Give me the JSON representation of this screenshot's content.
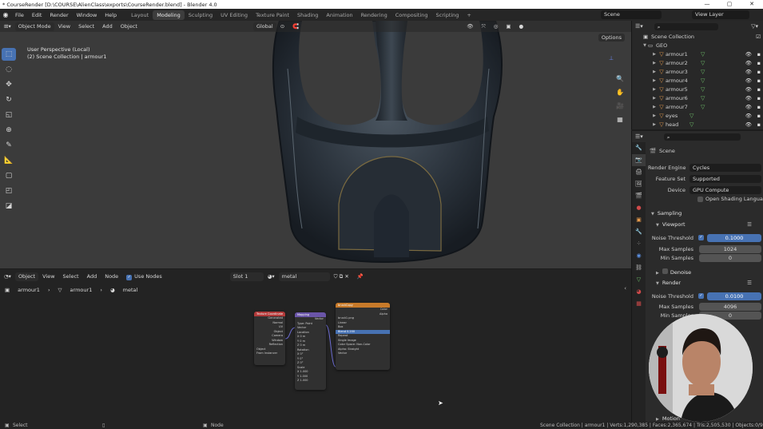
{
  "window": {
    "title": "* CourseRender [D:\\COURSE\\AlienClass\\exports\\CourseRender.blend] - Blender 4.0",
    "controls": [
      "—",
      "▢",
      "✕"
    ]
  },
  "menu": [
    "File",
    "Edit",
    "Render",
    "Window",
    "Help"
  ],
  "workspaces": [
    "Layout",
    "Modeling",
    "Sculpting",
    "UV Editing",
    "Texture Paint",
    "Shading",
    "Animation",
    "Rendering",
    "Compositing",
    "Scripting",
    "+"
  ],
  "active_workspace": "Modeling",
  "scene_name": "Scene",
  "view_layer": "View Layer",
  "viewport": {
    "mode": "Object Mode",
    "menus": [
      "View",
      "Select",
      "Add",
      "Object"
    ],
    "orientation": "Global",
    "info_line1": "User Perspective (Local)",
    "info_line2": "(2) Scene Collection | armour1",
    "options_label": "Options",
    "toolbar_icons": [
      "select-box-icon",
      "cursor-icon",
      "move-icon",
      "rotate-icon",
      "scale-icon",
      "transform-icon",
      "annotate-icon",
      "measure-icon",
      "add-cube-icon",
      "extrude-icon",
      "shear-icon"
    ],
    "nav_icons": [
      "zoom-icon",
      "pan-hand-icon",
      "camera-icon",
      "grid-icon"
    ]
  },
  "node_editor": {
    "editor_type": "Object",
    "menus": [
      "View",
      "Select",
      "Add",
      "Node"
    ],
    "use_nodes_label": "Use Nodes",
    "slot": "Slot 1",
    "material": "metal",
    "breadcrumb": [
      "armour1",
      "armour1",
      "metal"
    ],
    "nodes": [
      {
        "title": "Texture Coordinate",
        "color": "#b23a3a",
        "rows": [
          "Generated",
          "Normal",
          "UV",
          "Object",
          "Camera",
          "Window",
          "Reflection",
          "Object",
          "From Instancer"
        ]
      },
      {
        "title": "Mapping",
        "color": "#6a55a8",
        "rows": [
          "Vector",
          "Type: Point",
          "Vector",
          "Location",
          "X 0 m",
          "Y 0 m",
          "Z 0 m",
          "Rotation",
          "X 0°",
          "Y 0°",
          "Z 0°",
          "Scale",
          "X 1.000",
          "Y 1.000",
          "Z 1.000"
        ]
      },
      {
        "title": "brushCopy",
        "color": "#c77a2a",
        "rows": [
          "Color",
          "Alpha",
          "brush1.png",
          "Linear",
          "Box",
          "Blend 0.200",
          "Repeat",
          "Single Image",
          "Color Space: Non-Color",
          "Alpha: Straight",
          "Vector"
        ]
      }
    ]
  },
  "outliner": {
    "root": "Scene Collection",
    "collection": "GEO",
    "objects": [
      "armour1",
      "armour2",
      "armour3",
      "armour4",
      "armour5",
      "armour6",
      "armour7",
      "eyes",
      "head"
    ]
  },
  "properties": {
    "context": "Scene",
    "render_engine_label": "Render Engine",
    "render_engine": "Cycles",
    "feature_set_label": "Feature Set",
    "feature_set": "Supported",
    "device_label": "Device",
    "device": "GPU Compute",
    "osl_label": "Open Shading Language",
    "sampling_label": "Sampling",
    "viewport_label": "Viewport",
    "noise_threshold_label": "Noise Threshold",
    "viewport_noise_threshold": "0.1000",
    "max_samples_label": "Max Samples",
    "viewport_max_samples": "1024",
    "min_samples_label": "Min Samples",
    "viewport_min_samples": "0",
    "denoise_label": "Denoise",
    "render_label": "Render",
    "render_noise_threshold": "0.0100",
    "render_max_samples": "4096",
    "render_min_samples": "0",
    "motion_label": "Motion"
  },
  "status": {
    "left1": "Select",
    "left2": "Node",
    "right": "Scene Collection | armour1 | Verts:1,290,385 | Faces:2,365,674 | Tris:2,505,530 | Objects:0/9"
  }
}
